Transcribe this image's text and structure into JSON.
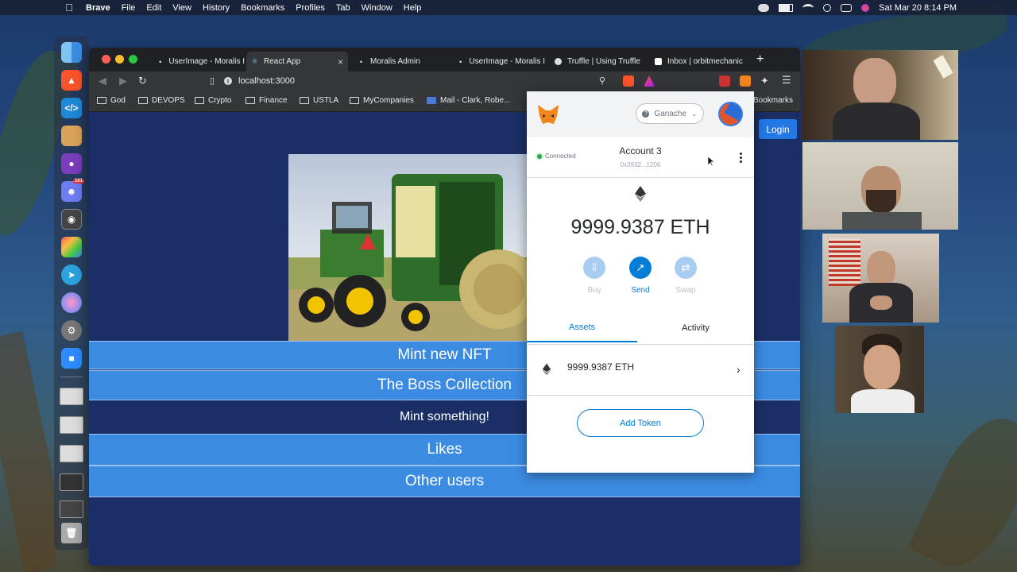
{
  "menubar": {
    "app": "Brave",
    "items": [
      "File",
      "Edit",
      "View",
      "History",
      "Bookmarks",
      "Profiles",
      "Tab",
      "Window",
      "Help"
    ],
    "datetime": "Sat Mar 20  8:14 PM"
  },
  "dock": {
    "icons": [
      "finder-icon",
      "brave-icon",
      "vscode-icon",
      "box-icon",
      "github-icon",
      "discord-icon",
      "screenshot-icon",
      "launchpad-icon",
      "telegram-icon",
      "siri-icon",
      "system-preferences-icon",
      "zoom-icon"
    ],
    "discord_badge": "101"
  },
  "browser": {
    "tabs": [
      {
        "label": "UserImage - Moralis I",
        "active": false
      },
      {
        "label": "React App",
        "active": true
      },
      {
        "label": "Moralis Admin",
        "active": false
      },
      {
        "label": "UserImage - Moralis I",
        "active": false
      },
      {
        "label": "Truffle | Using Truffle",
        "active": false
      },
      {
        "label": "Inbox | orbitmechanic",
        "active": false
      }
    ],
    "url": "localhost:3000",
    "bookmarks": [
      "God",
      "DEVOPS",
      "Crypto",
      "Finance",
      "USTLA",
      "MyCompanies",
      "Mail - Clark, Robe..."
    ],
    "bookmarks_overflow": "Bookmarks"
  },
  "page": {
    "login_label": "Login",
    "strips": {
      "mint_new": "Mint new NFT",
      "boss_collection": "The Boss Collection",
      "mint_something": "Mint something!",
      "likes": "Likes",
      "other_users": "Other users"
    }
  },
  "metamask": {
    "network": "Ganache",
    "status": "Connected",
    "account_name": "Account 3",
    "account_address": "0x3932...1206",
    "balance": "9999.9387 ETH",
    "actions": {
      "buy": "Buy",
      "send": "Send",
      "swap": "Swap"
    },
    "tabs": {
      "assets": "Assets",
      "activity": "Activity"
    },
    "asset_amount": "9999.9387 ETH",
    "add_token": "Add Token"
  },
  "colors": {
    "page_bg": "#1b2f66",
    "strip_blue": "#3c8be3",
    "metamask_blue": "#037dd6",
    "login_blue": "#2378e6"
  }
}
